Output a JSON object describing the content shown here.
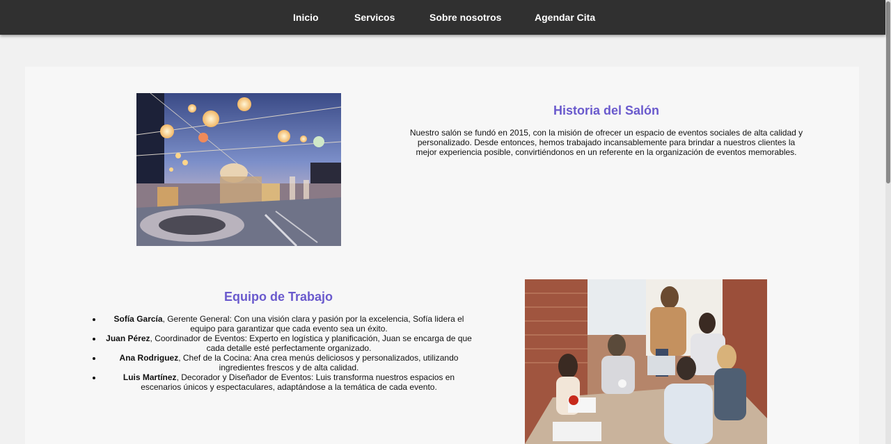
{
  "nav": {
    "items": [
      {
        "label": "Inicio"
      },
      {
        "label": "Servicos"
      },
      {
        "label": "Sobre nosotros"
      },
      {
        "label": "Agendar Cita"
      }
    ]
  },
  "history": {
    "title": "Historia del Salón",
    "text": "Nuestro salón se fundó en 2015, con la misión de ofrecer un espacio de eventos sociales de alta calidad y personalizado. Desde entonces, hemos trabajado incansablemente para brindar a nuestros clientes la mejor experiencia posible, convirtiéndonos en un referente en la organización de eventos memorables."
  },
  "team": {
    "title": "Equipo de Trabajo",
    "members": [
      {
        "name": "Sofía García",
        "description": ", Gerente General: Con una visión clara y pasión por la excelencia, Sofía lidera el equipo para garantizar que cada evento sea un éxito."
      },
      {
        "name": "Juan Pérez",
        "description": ", Coordinador de Eventos: Experto en logística y planificación, Juan se encarga de que cada detalle esté perfectamente organizado."
      },
      {
        "name": "Ana Rodriguez",
        "description": ", Chef de la Cocina: Ana crea menús deliciosos y personalizados, utilizando ingredientes frescos y de alta calidad."
      },
      {
        "name": "Luis Martínez",
        "description": ", Decorador y Diseñador de Eventos: Luis transforma nuestros espacios en escenarios únicos y espectaculares, adaptándose a la temática de cada evento."
      }
    ]
  },
  "colors": {
    "navbar": "#303030",
    "title": "#6a5acd",
    "page_background": "#f1f1f1",
    "panel_background": "#f7f7f7"
  }
}
